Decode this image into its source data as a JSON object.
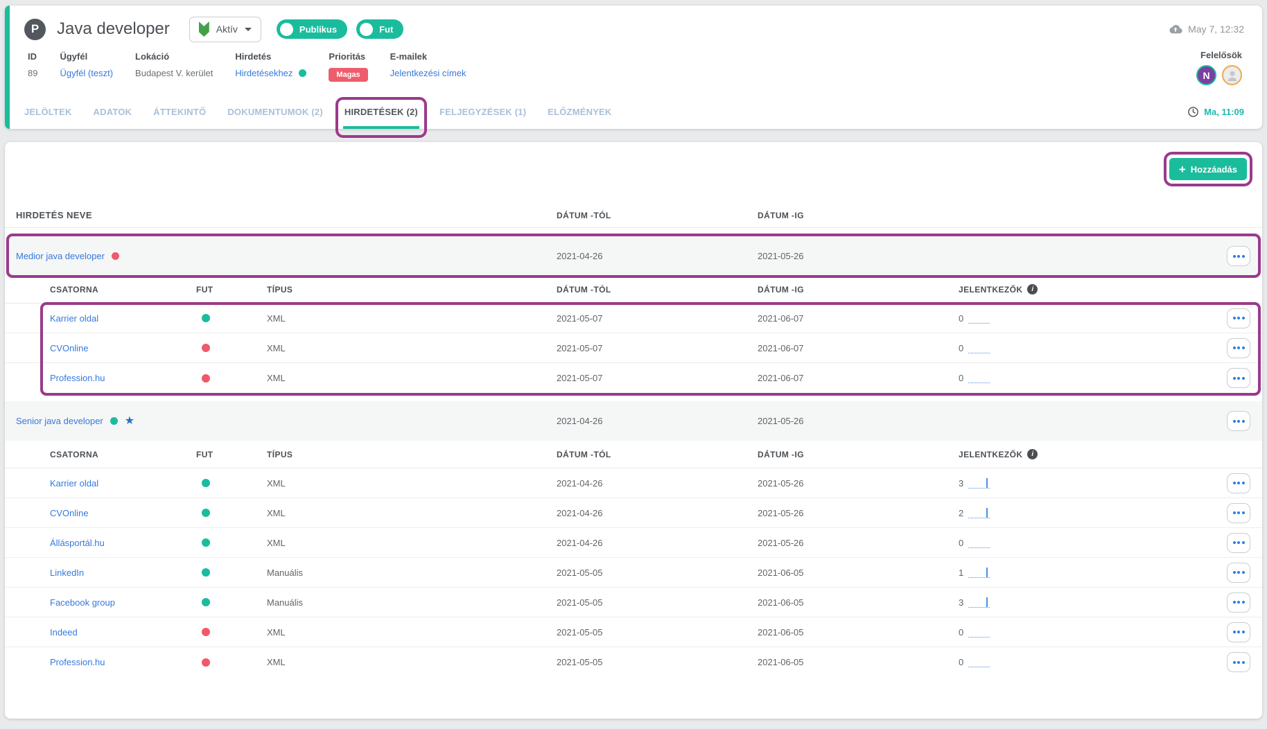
{
  "colors": {
    "teal": "#1abc9c",
    "red": "#f0586c",
    "purple_annotation": "#9a3a8c",
    "link_blue": "#3579de",
    "sparkline_blue": "#4a90e2",
    "inactive_tab": "#a8c0d8",
    "badge_red": "#ee5d6c",
    "avatar_purple": "#7b3fa0",
    "avatar_ring_orange": "#f0a84b",
    "activity_teal": "#1cb8b2"
  },
  "header": {
    "logo_letter": "P",
    "title": "Java developer",
    "status_dropdown_label": "Aktív",
    "toggles": [
      {
        "label": "Publikus"
      },
      {
        "label": "Fut"
      }
    ],
    "saved_at": "May 7, 12:32",
    "info_columns": [
      {
        "label": "ID",
        "value": "89",
        "type": "text"
      },
      {
        "label": "Ügyfél",
        "value": "Ügyfél (teszt)",
        "type": "link"
      },
      {
        "label": "Lokáció",
        "value": "Budapest V. kerület",
        "type": "text"
      },
      {
        "label": "Hirdetés",
        "value": "Hirdetésekhez",
        "type": "link",
        "dot": "green"
      },
      {
        "label": "Prioritás",
        "value": "Magas",
        "type": "badge"
      },
      {
        "label": "E-mailek",
        "value": "Jelentkezési címek",
        "type": "link"
      }
    ],
    "responsibles_label": "Felelősök",
    "avatars": [
      {
        "initial": "N"
      },
      {
        "initial": ""
      }
    ],
    "tabs": [
      {
        "label": "JELÖLTEK",
        "active": false
      },
      {
        "label": "ADATOK",
        "active": false
      },
      {
        "label": "ÁTTEKINTŐ",
        "active": false
      },
      {
        "label": "DOKUMENTUMOK (2)",
        "active": false
      },
      {
        "label": "HIRDETÉSEK (2)",
        "active": true,
        "annotated": true
      },
      {
        "label": "FELJEGYZÉSEK (1)",
        "active": false
      },
      {
        "label": "ELŐZMÉNYEK",
        "active": false
      }
    ],
    "last_activity": "Ma, 11:09"
  },
  "content": {
    "add_button_label": "Hozzáadás",
    "add_button_annotated": true,
    "table_headers": {
      "name": "HIRDETÉS NEVE",
      "from": "DÁTUM -TÓL",
      "to": "DÁTUM -IG"
    },
    "sub_headers": {
      "channel": "CSATORNA",
      "running": "FUT",
      "type": "TÍPUS",
      "from": "DÁTUM -TÓL",
      "to": "DÁTUM -IG",
      "applicants": "JELENTKEZŐK"
    },
    "ads": [
      {
        "name": "Medior java developer",
        "status": "red",
        "starred": false,
        "from": "2021-04-26",
        "to": "2021-05-26",
        "row_annotated": true,
        "channels_annotated": true,
        "channels": [
          {
            "name": "Karrier oldal",
            "status": "green",
            "type": "XML",
            "from": "2021-05-07",
            "to": "2021-06-07",
            "applicants": 0
          },
          {
            "name": "CVOnline",
            "status": "red",
            "type": "XML",
            "from": "2021-05-07",
            "to": "2021-06-07",
            "applicants": 0
          },
          {
            "name": "Profession.hu",
            "status": "red",
            "type": "XML",
            "from": "2021-05-07",
            "to": "2021-06-07",
            "applicants": 0
          }
        ]
      },
      {
        "name": "Senior java developer",
        "status": "green",
        "starred": true,
        "from": "2021-04-26",
        "to": "2021-05-26",
        "row_annotated": false,
        "channels_annotated": false,
        "channels": [
          {
            "name": "Karrier oldal",
            "status": "green",
            "type": "XML",
            "from": "2021-04-26",
            "to": "2021-05-26",
            "applicants": 3
          },
          {
            "name": "CVOnline",
            "status": "green",
            "type": "XML",
            "from": "2021-04-26",
            "to": "2021-05-26",
            "applicants": 2
          },
          {
            "name": "Állásportál.hu",
            "status": "green",
            "type": "XML",
            "from": "2021-04-26",
            "to": "2021-05-26",
            "applicants": 0
          },
          {
            "name": "LinkedIn",
            "status": "green",
            "type": "Manuális",
            "from": "2021-05-05",
            "to": "2021-06-05",
            "applicants": 1
          },
          {
            "name": "Facebook group",
            "status": "green",
            "type": "Manuális",
            "from": "2021-05-05",
            "to": "2021-06-05",
            "applicants": 3
          },
          {
            "name": "Indeed",
            "status": "red",
            "type": "XML",
            "from": "2021-05-05",
            "to": "2021-06-05",
            "applicants": 0
          },
          {
            "name": "Profession.hu",
            "status": "red",
            "type": "XML",
            "from": "2021-05-05",
            "to": "2021-06-05",
            "applicants": 0
          }
        ]
      }
    ]
  }
}
